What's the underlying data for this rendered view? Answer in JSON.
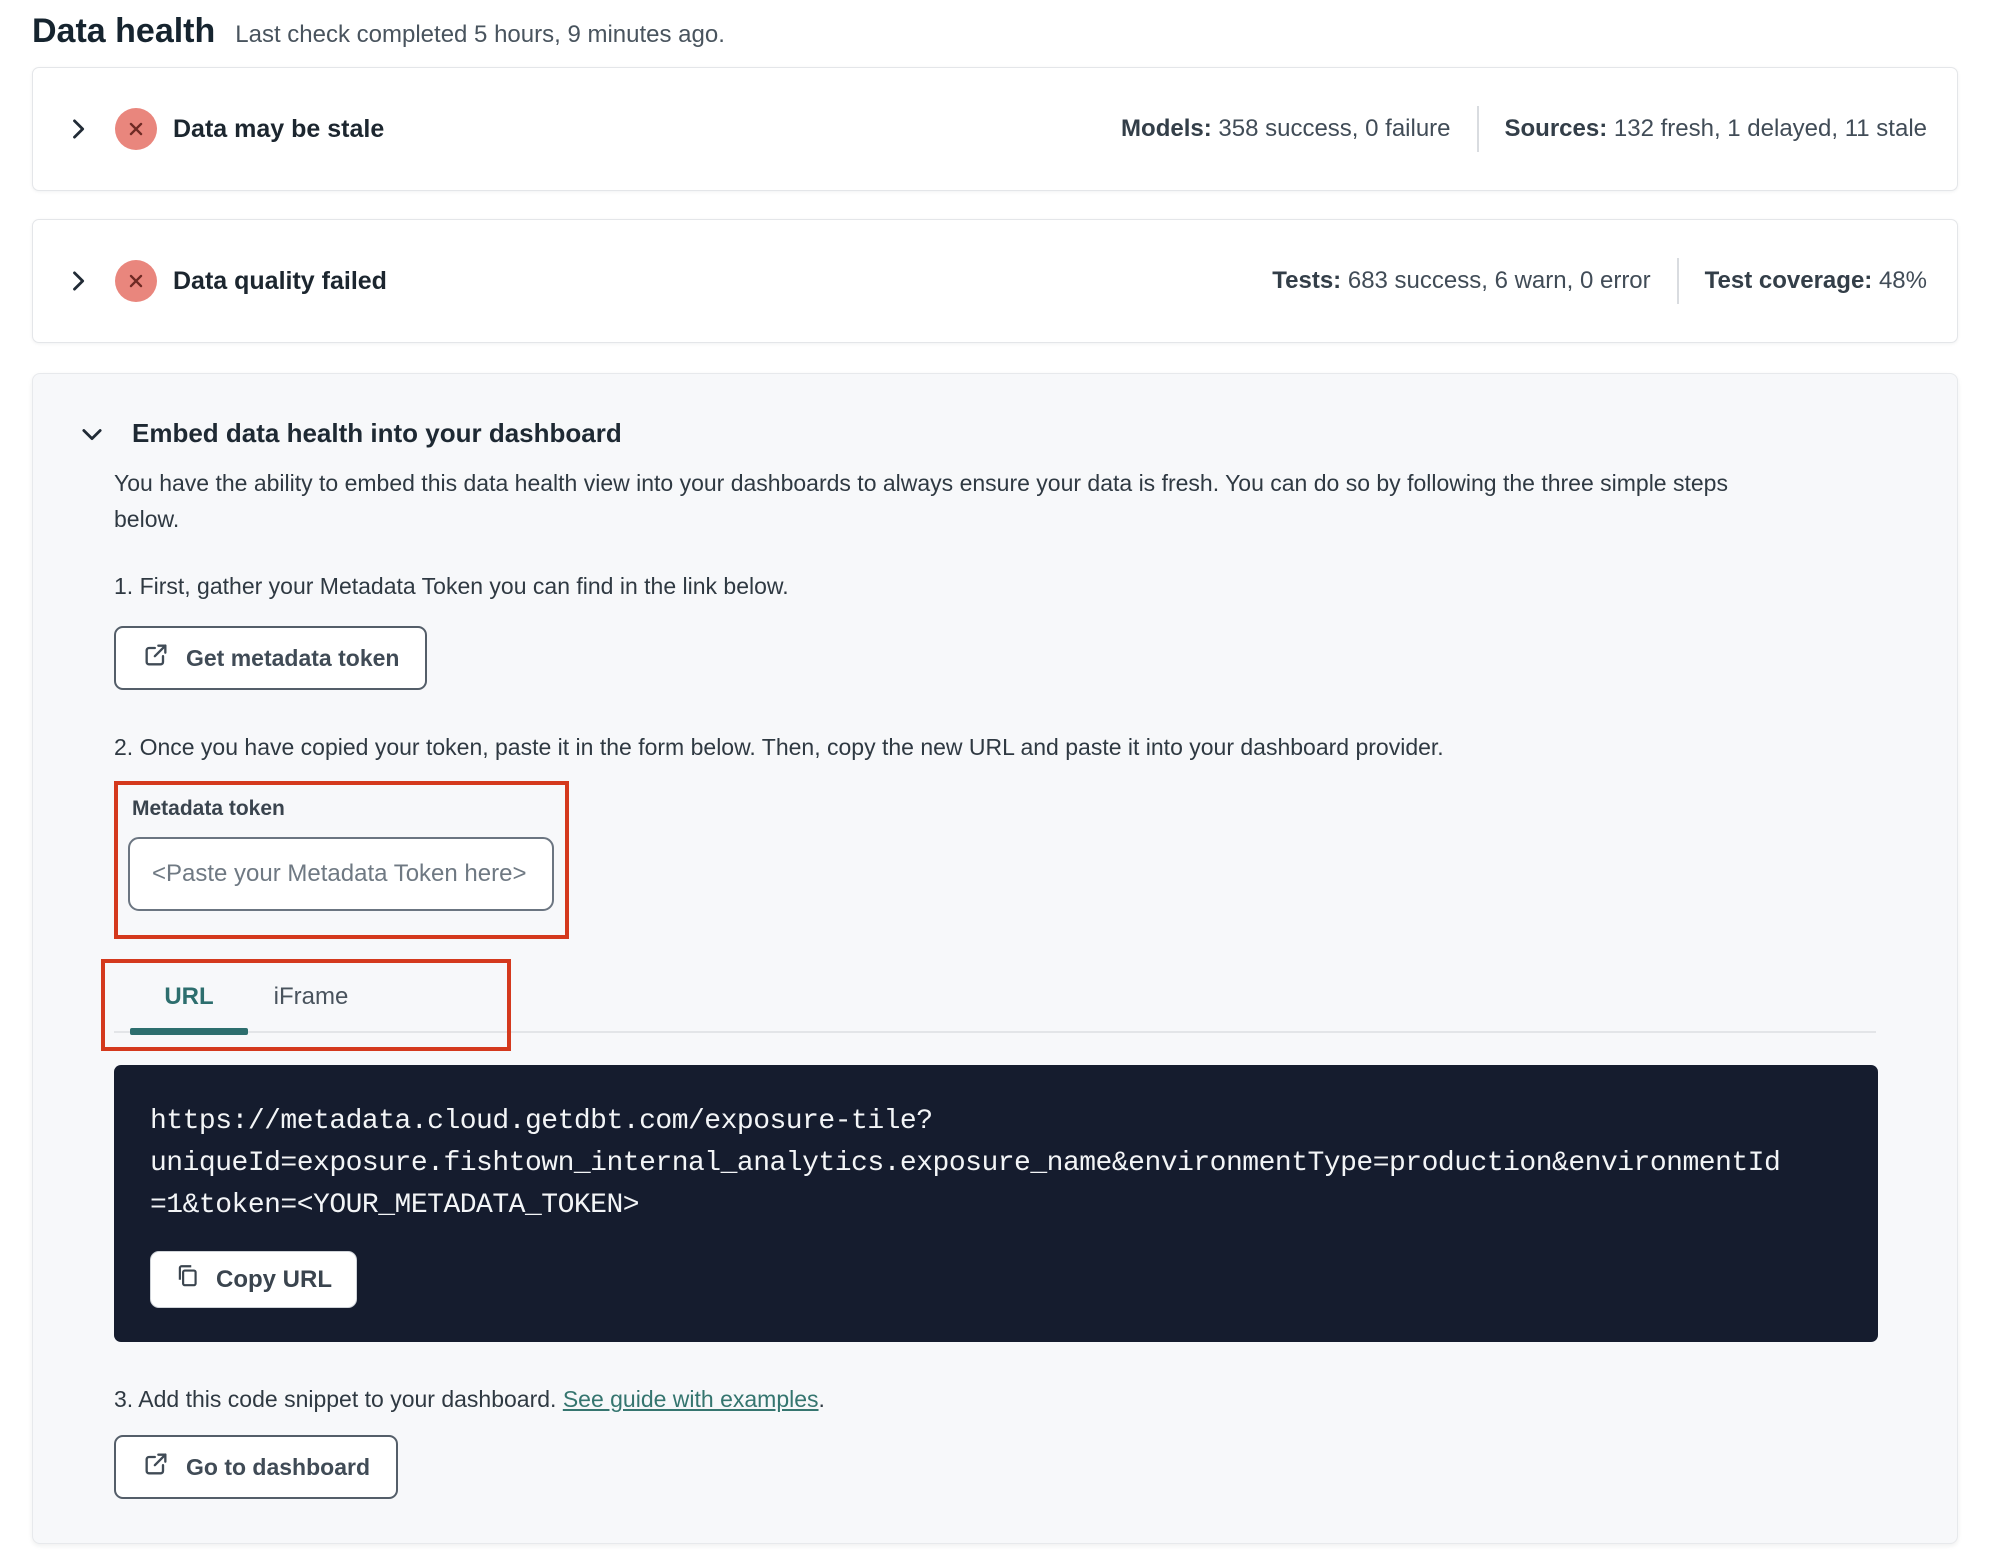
{
  "colors": {
    "annotation_red": "#d4391d",
    "teal_accent": "#2d6e6e",
    "link_teal": "#35756f",
    "error_salmon": "#e9867d",
    "error_x": "#6e2a24",
    "code_bg": "#151c2e"
  },
  "page": {
    "title": "Data health",
    "last_check": "Last check completed 5 hours, 9 minutes ago."
  },
  "rows": {
    "stale": {
      "title": "Data may be stale",
      "stats": [
        {
          "label": "Models:",
          "value": "358 success, 0 failure"
        },
        {
          "label": "Sources:",
          "value": "132 fresh, 1 delayed, 11 stale"
        }
      ]
    },
    "quality": {
      "title": "Data quality failed",
      "stats": [
        {
          "label": "Tests:",
          "value": "683 success, 6 warn, 0 error"
        },
        {
          "label": "Test coverage:",
          "value": "48%"
        }
      ]
    }
  },
  "embed": {
    "heading": "Embed data health into your dashboard",
    "description": "You have the ability to embed this data health view into your dashboards to always ensure your data is fresh. You can do so by following the three simple steps below.",
    "step1": "1. First, gather your Metadata Token you can find in the link below.",
    "get_token_button": "Get metadata token",
    "step2": "2. Once you have copied your token, paste it in the form below. Then, copy the new URL and paste it into your dashboard provider.",
    "token_label": "Metadata token",
    "token_placeholder": "<Paste your Metadata Token here>",
    "tabs": {
      "url": "URL",
      "iframe": "iFrame"
    },
    "code_lines": [
      "https://metadata.cloud.getdbt.com/exposure-tile?",
      "uniqueId=exposure.fishtown_internal_analytics.exposure_name&environmentType=production&environmentId",
      "=1&token=<YOUR_METADATA_TOKEN>"
    ],
    "copy_url_button": "Copy URL",
    "step3_prefix": "3. Add this code snippet to your dashboard. ",
    "step3_link": "See guide with examples",
    "step3_suffix": ".",
    "dashboard_button": "Go to dashboard"
  }
}
